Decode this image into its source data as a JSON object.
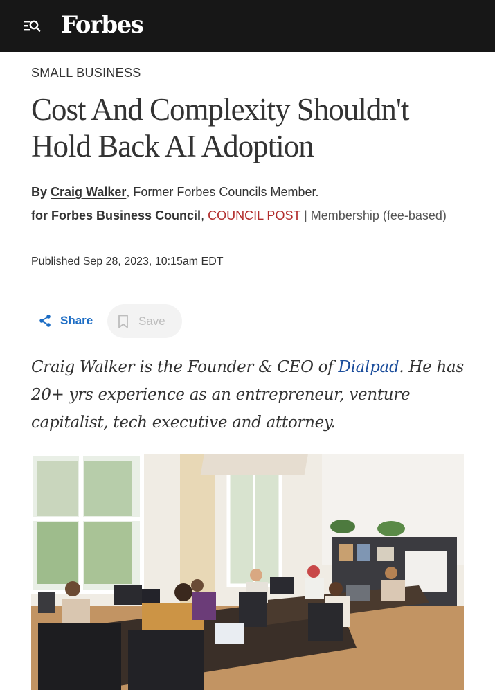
{
  "header": {
    "logo": "Forbes",
    "menu_icon": "menu-search-icon"
  },
  "article": {
    "category": "SMALL BUSINESS",
    "headline_line1": "Cost And Complexity Shouldn't",
    "headline_line2": "Hold Back AI Adoption",
    "byline": {
      "by": "By",
      "author": "Craig Walker",
      "author_role": ", Former Forbes Councils Member.",
      "for": "for",
      "council": "Forbes Business Council",
      "comma": ",",
      "post_type": "COUNCIL POST",
      "membership": " | Membership (fee-based)"
    },
    "published": "Published Sep 28, 2023, 10:15am EDT",
    "summary_before": "Craig Walker is the Founder & CEO of ",
    "summary_link": "Dialpad",
    "summary_after": ". He has 20+ yrs experience as an entrepreneur, venture capitalist, tech executive and attorney."
  },
  "actions": {
    "share_label": "Share",
    "save_label": "Save",
    "share_icon": "share-icon",
    "save_icon": "bookmark-icon"
  },
  "colors": {
    "topbar": "#171717",
    "link_blue": "#1b6cc4",
    "council_red": "#b12b2b",
    "summary_link": "#1c4e9c"
  }
}
